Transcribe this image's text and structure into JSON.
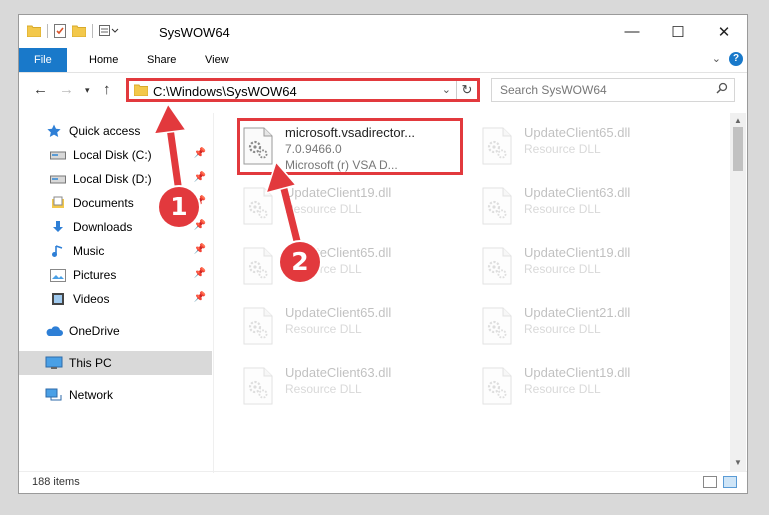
{
  "window": {
    "title": "SysWOW64",
    "controls": {
      "minimize": "—",
      "maximize": "☐",
      "close": "✕"
    }
  },
  "ribbon": {
    "tabs": [
      "File",
      "Home",
      "Share",
      "View"
    ],
    "help": "?"
  },
  "address": {
    "path": "C:\\Windows\\SysWOW64",
    "search_placeholder": "Search SysWOW64"
  },
  "nav": {
    "items": [
      {
        "label": "Quick access",
        "icon": "star-icon",
        "pinned": false
      },
      {
        "label": "Local Disk (C:)",
        "icon": "drive-icon",
        "pinned": true
      },
      {
        "label": "Local Disk (D:)",
        "icon": "drive-icon",
        "pinned": true
      },
      {
        "label": "Documents",
        "icon": "documents-icon",
        "pinned": true
      },
      {
        "label": "Downloads",
        "icon": "download-icon",
        "pinned": true
      },
      {
        "label": "Music",
        "icon": "music-icon",
        "pinned": true
      },
      {
        "label": "Pictures",
        "icon": "pictures-icon",
        "pinned": true
      },
      {
        "label": "Videos",
        "icon": "videos-icon",
        "pinned": true
      },
      {
        "label": "OneDrive",
        "icon": "cloud-icon",
        "pinned": false
      },
      {
        "label": "This PC",
        "icon": "computer-icon",
        "pinned": false,
        "selected": true
      },
      {
        "label": "Network",
        "icon": "network-icon",
        "pinned": false
      }
    ]
  },
  "files": [
    {
      "name": "microsoft.vsadirector...",
      "line2": "7.0.9466.0",
      "line3": "Microsoft (r) VSA D...",
      "faded": false
    },
    {
      "name": "UpdateClient65.dll",
      "line2": "Resource DLL",
      "faded": true
    },
    {
      "name": "UpdateClient19.dll",
      "line2": "Resource DLL",
      "faded": true
    },
    {
      "name": "UpdateClient63.dll",
      "line2": "Resource DLL",
      "faded": true
    },
    {
      "name": "UpdateClient65.dll",
      "line2": "Resource DLL",
      "faded": true
    },
    {
      "name": "UpdateClient19.dll",
      "line2": "Resource DLL",
      "faded": true
    },
    {
      "name": "UpdateClient65.dll",
      "line2": "Resource DLL",
      "faded": true
    },
    {
      "name": "UpdateClient21.dll",
      "line2": "Resource DLL",
      "faded": true
    },
    {
      "name": "UpdateClient63.dll",
      "line2": "Resource DLL",
      "faded": true
    },
    {
      "name": "UpdateClient19.dll",
      "line2": "Resource DLL",
      "faded": true
    }
  ],
  "status": {
    "count": "188 items"
  },
  "annotations": {
    "step1": "1",
    "step2": "2",
    "color": "#e2393d"
  }
}
